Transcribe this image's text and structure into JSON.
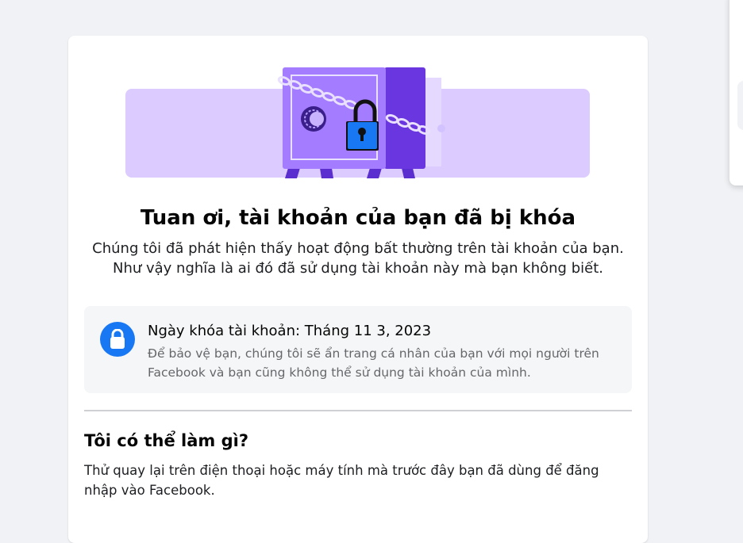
{
  "locked_page": {
    "title": "Tuan ơi, tài khoản của bạn đã bị khóa",
    "subtitle": "Chúng tôi đã phát hiện thấy hoạt động bất thường trên tài khoản của bạn. Như vậy nghĩa là ai đó đã sử dụng tài khoản này mà bạn không biết.",
    "lock_info": {
      "title": "Ngày khóa tài khoản: Tháng 11 3, 2023",
      "description": "Để bảo vệ bạn, chúng tôi sẽ ẩn trang cá nhân của bạn với mọi người trên Facebook và bạn cũng không thể sử dụng tài khoản của mình.",
      "icon": "lock-icon"
    },
    "what_to_do": {
      "title": "Tôi có thể làm gì?",
      "description": "Thử quay lại trên điện thoại hoặc máy tính mà trước đây bạn đã dùng để đăng nhập vào Facebook."
    },
    "illustration": "locked-safe-illustration"
  },
  "colors": {
    "accent_blue": "#1877f2",
    "page_background": "#f0f2f5",
    "illustration_purple": "#a47cff",
    "illustration_light_purple": "#dccbff"
  }
}
